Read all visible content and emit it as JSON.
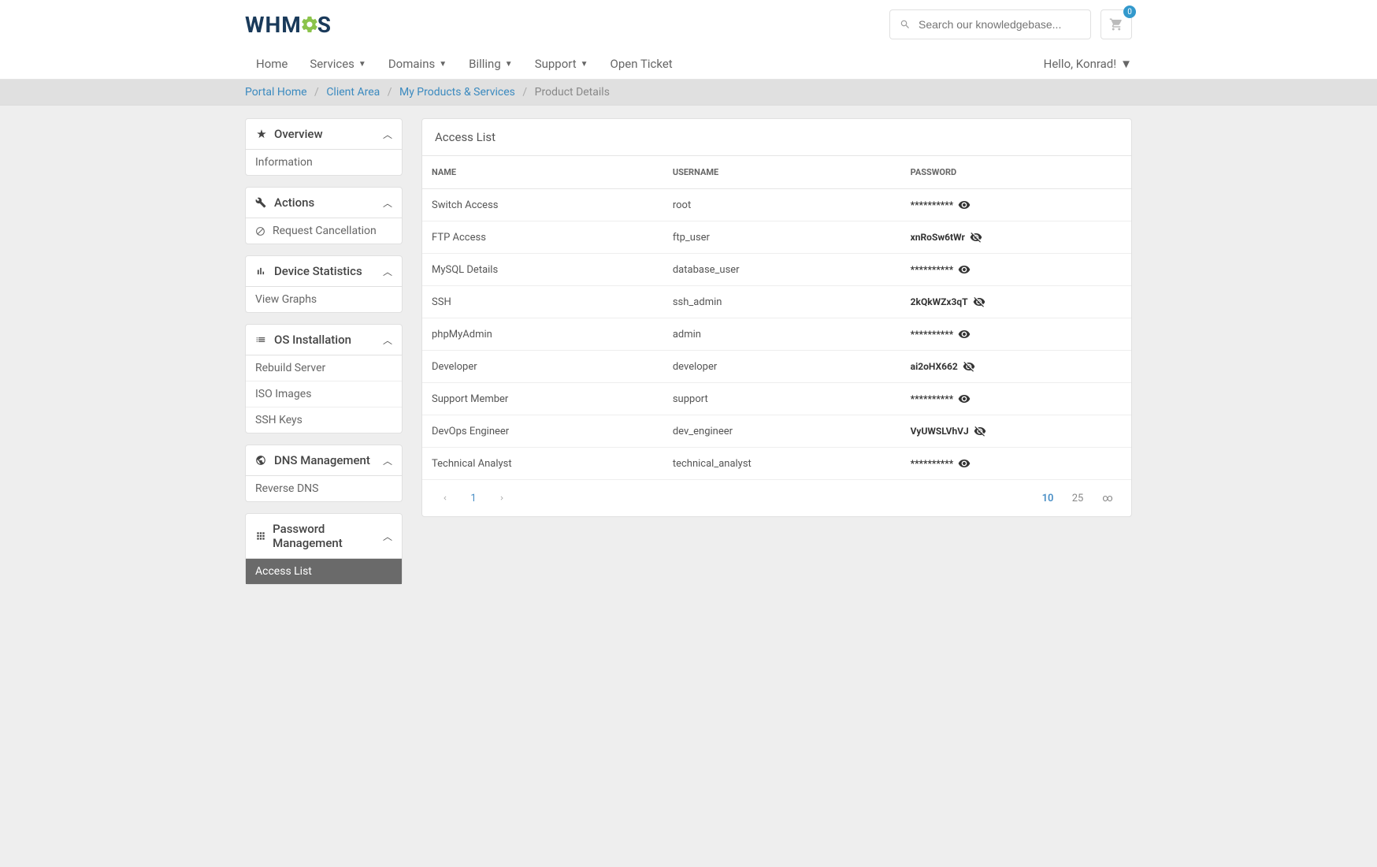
{
  "logo": {
    "pre": "WHM",
    "post": "S"
  },
  "search": {
    "placeholder": "Search our knowledgebase..."
  },
  "cart": {
    "count": "0"
  },
  "nav": {
    "home": "Home",
    "services": "Services",
    "domains": "Domains",
    "billing": "Billing",
    "support": "Support",
    "openTicket": "Open Ticket",
    "hello": "Hello, Konrad!"
  },
  "breadcrumb": {
    "portalHome": "Portal Home",
    "clientArea": "Client Area",
    "myProducts": "My Products & Services",
    "productDetails": "Product Details"
  },
  "sidebar": {
    "overview": {
      "title": "Overview",
      "information": "Information"
    },
    "actions": {
      "title": "Actions",
      "requestCancellation": "Request Cancellation"
    },
    "deviceStats": {
      "title": "Device Statistics",
      "viewGraphs": "View Graphs"
    },
    "osInstall": {
      "title": "OS Installation",
      "rebuild": "Rebuild Server",
      "iso": "ISO Images",
      "ssh": "SSH Keys"
    },
    "dns": {
      "title": "DNS Management",
      "reverse": "Reverse DNS"
    },
    "pwmgmt": {
      "title": "Password Management",
      "access": "Access List"
    }
  },
  "main": {
    "title": "Access List",
    "headers": {
      "name": "NAME",
      "username": "USERNAME",
      "password": "PASSWORD"
    },
    "rows": [
      {
        "name": "Switch Access",
        "user": "root",
        "pw": "**********",
        "revealed": false
      },
      {
        "name": "FTP Access",
        "user": "ftp_user",
        "pw": "xnRoSw6tWr",
        "revealed": true
      },
      {
        "name": "MySQL Details",
        "user": "database_user",
        "pw": "**********",
        "revealed": false
      },
      {
        "name": "SSH",
        "user": "ssh_admin",
        "pw": "2kQkWZx3qT",
        "revealed": true
      },
      {
        "name": "phpMyAdmin",
        "user": "admin",
        "pw": "**********",
        "revealed": false
      },
      {
        "name": "Developer",
        "user": "developer",
        "pw": "ai2oHX662",
        "revealed": true
      },
      {
        "name": "Support Member",
        "user": "support",
        "pw": "**********",
        "revealed": false
      },
      {
        "name": "DevOps Engineer",
        "user": "dev_engineer",
        "pw": "VyUWSLVhVJ",
        "revealed": true
      },
      {
        "name": "Technical Analyst",
        "user": "technical_analyst",
        "pw": "**********",
        "revealed": false
      }
    ],
    "pagination": {
      "page": "1",
      "sizes": [
        "10",
        "25",
        "∞"
      ],
      "activeSize": "10"
    }
  }
}
